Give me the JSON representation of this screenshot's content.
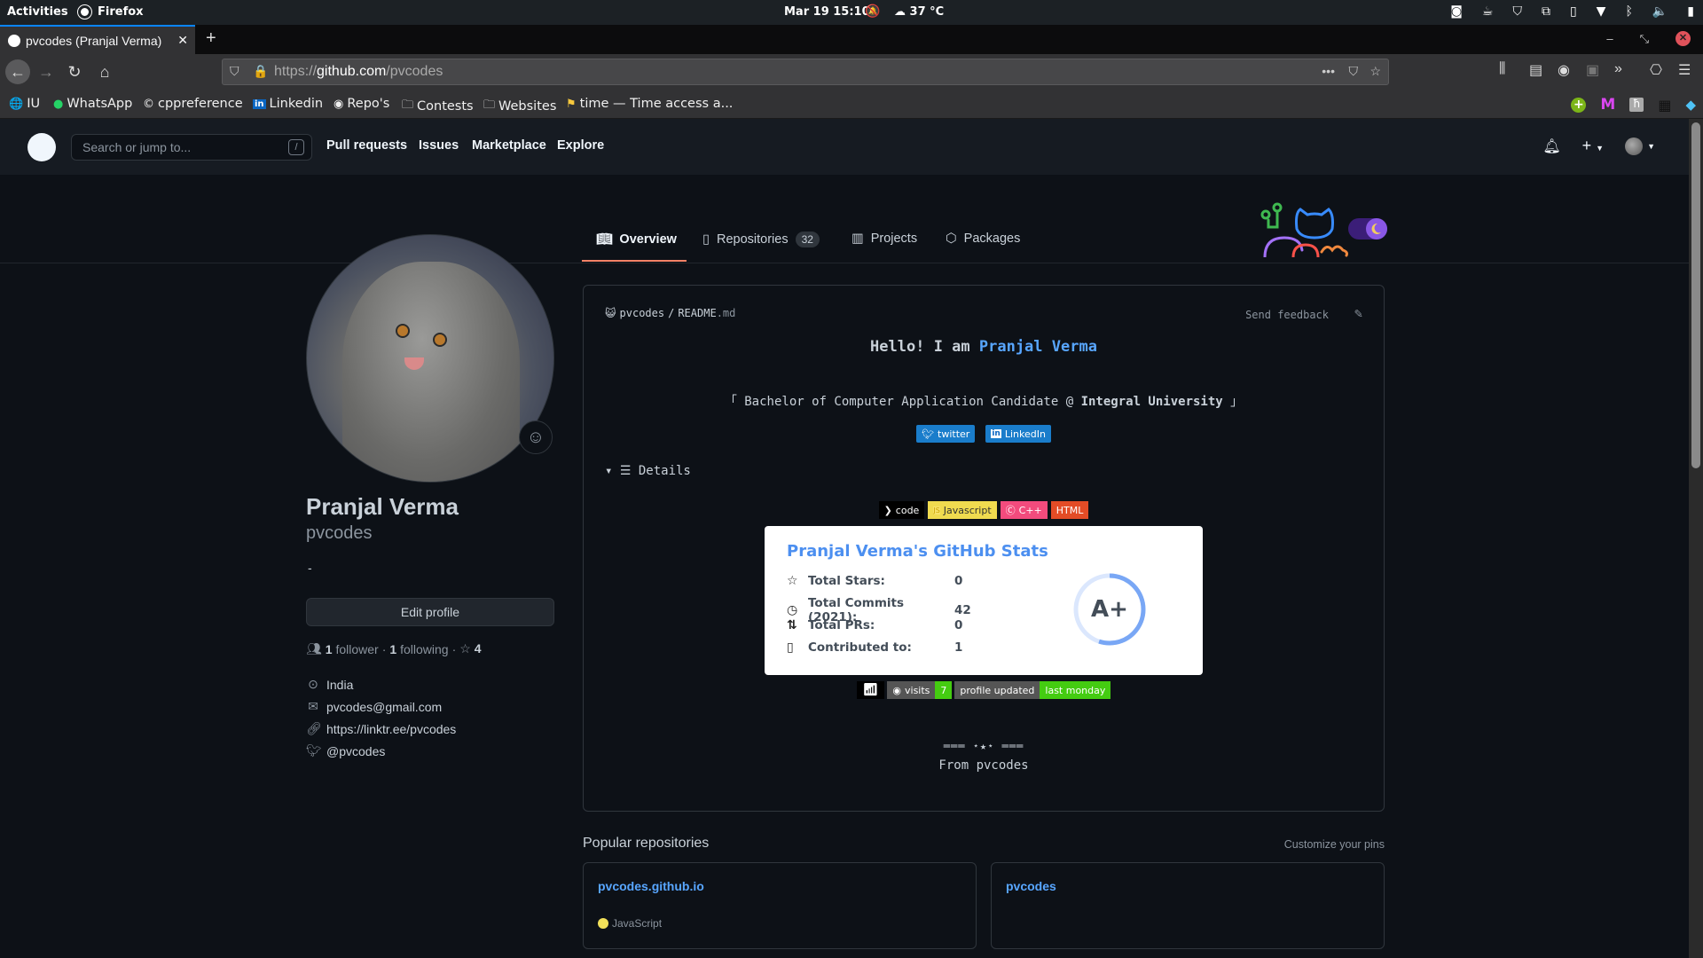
{
  "system_bar": {
    "activities": "Activities",
    "app": "Firefox",
    "clock": "Mar 19  15:10",
    "weather": "37 °C"
  },
  "browser": {
    "tab_title": "pvcodes (Pranjal Verma)",
    "url_prefix": "https://",
    "url_domain": "github.com",
    "url_path": "/pvcodes",
    "bookmarks": [
      {
        "label": "IU",
        "icon": "globe-icon"
      },
      {
        "label": "WhatsApp",
        "icon": "whatsapp-icon"
      },
      {
        "label": "cppreference",
        "icon": "cppreference-icon"
      },
      {
        "label": "Linkedin",
        "icon": "linkedin-icon"
      },
      {
        "label": "Repo's",
        "icon": "github-icon"
      },
      {
        "label": "Contests",
        "icon": "folder-icon"
      },
      {
        "label": "Websites",
        "icon": "folder-icon"
      },
      {
        "label": "time — Time access a...",
        "icon": "python-icon"
      }
    ]
  },
  "github_header": {
    "search_placeholder": "Search or jump to...",
    "search_shortcut": "/",
    "nav": [
      "Pull requests",
      "Issues",
      "Marketplace",
      "Explore"
    ]
  },
  "profile_tabs": [
    {
      "label": "Overview",
      "active": true
    },
    {
      "label": "Repositories",
      "count": "32"
    },
    {
      "label": "Projects"
    },
    {
      "label": "Packages"
    }
  ],
  "profile": {
    "name": "Pranjal Verma",
    "login": "pvcodes",
    "bio": "-",
    "edit_button": "Edit profile",
    "followers": "1",
    "followers_label": "follower",
    "following": "1",
    "following_label": "following",
    "stars": "4",
    "location": "India",
    "email": "pvcodes@gmail.com",
    "website": "https://linktr.ee/pvcodes",
    "twitter": "@pvcodes"
  },
  "readme": {
    "path_user": "pvcodes",
    "path_sep": "/",
    "path_file": "README",
    "path_ext": ".md",
    "send_feedback": "Send feedback",
    "hello_prefix": "Hello! I am ",
    "hello_name": "Pranjal Verma",
    "bachelor_prefix": "「 Bachelor of Computer Application Candidate @ ",
    "bachelor_uni": "Integral University",
    "bachelor_suffix": " 」",
    "social": [
      {
        "label": "twitter",
        "icon": "twitter-icon"
      },
      {
        "label": "LinkedIn",
        "icon": "linkedin-icon"
      }
    ],
    "details_label": "☰ Details",
    "lang_badges": [
      {
        "label": "code",
        "bg": "#000000",
        "fg": "#ffffff",
        "icon": "chevron-right-icon"
      },
      {
        "label": "Javascript",
        "bg": "#f0db4f",
        "fg": "#323330",
        "icon": "js-icon"
      },
      {
        "label": "C++",
        "bg": "#f34b7d",
        "fg": "#ffffff",
        "icon": "cpp-icon"
      },
      {
        "label": "HTML",
        "bg": "#e34c26",
        "fg": "#ffffff",
        "icon": ""
      }
    ],
    "stats": {
      "title": "Pranjal Verma's GitHub Stats",
      "rows": [
        {
          "label": "Total Stars:",
          "value": "0",
          "icon": "star-icon"
        },
        {
          "label": "Total Commits (2021):",
          "value": "42",
          "icon": "history-icon"
        },
        {
          "label": "Total PRs:",
          "value": "0",
          "icon": "pull-request-icon"
        },
        {
          "label": "Contributed to:",
          "value": "1",
          "icon": "repo-icon"
        }
      ],
      "rank": "A+",
      "rank_progress": 0.55,
      "accent": "#79a7f5"
    },
    "visits_label": "visits",
    "visits_value": "7",
    "updated_label": "profile updated",
    "updated_value": "last monday",
    "divider": "═══  ⋆★⋆  ═══",
    "from_prefix": "From ",
    "from_name": "pvcodes"
  },
  "popular": {
    "title": "Popular repositories",
    "customize": "Customize your pins",
    "repos": [
      {
        "name": "pvcodes.github.io",
        "language": "JavaScript",
        "lang_color": "#f1e05a"
      },
      {
        "name": "pvcodes",
        "language": ""
      }
    ]
  }
}
